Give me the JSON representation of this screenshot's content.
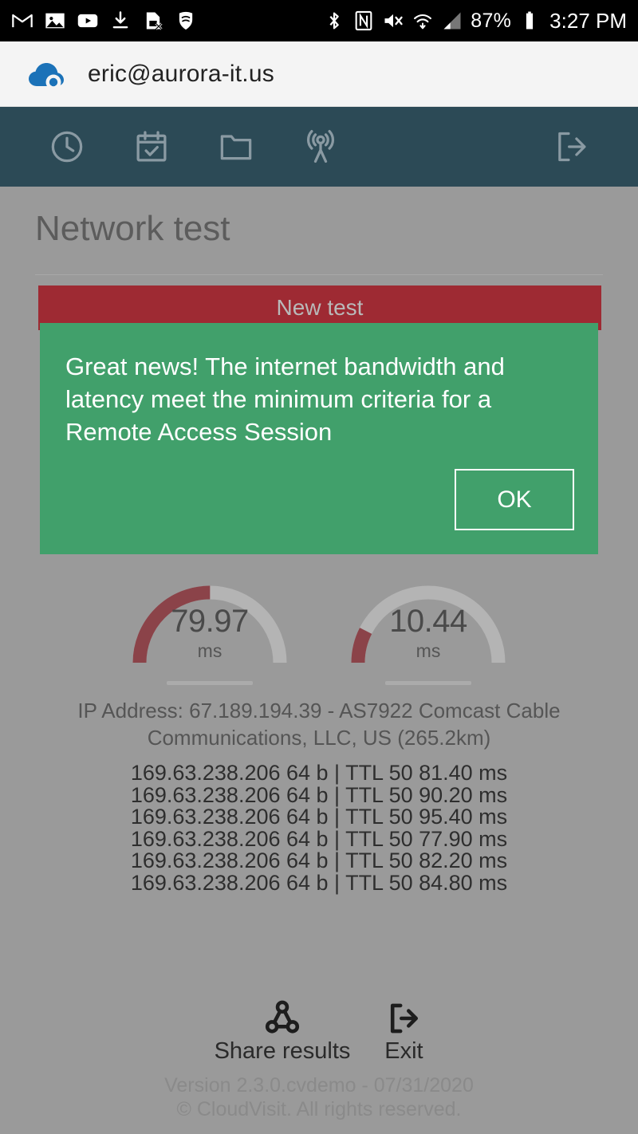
{
  "status_bar": {
    "notifications": [
      "gmail-icon",
      "photos-icon",
      "youtube-icon",
      "download-icon",
      "sim-card-error-icon",
      "shield-icon"
    ],
    "system": [
      "bluetooth-icon",
      "nfc-icon",
      "mute-icon",
      "wifi-icon",
      "cell-signal-icon"
    ],
    "battery_percent": "87%",
    "time": "3:27 PM"
  },
  "account": {
    "email": "eric@aurora-it.us",
    "logo": "cloudvisit-cloud-logo"
  },
  "nav": {
    "items": [
      {
        "name": "history",
        "icon": "clock-icon"
      },
      {
        "name": "appointments",
        "icon": "calendar-check-icon"
      },
      {
        "name": "files",
        "icon": "folder-icon"
      },
      {
        "name": "network-test",
        "icon": "broadcast-icon"
      }
    ],
    "logout": {
      "name": "logout",
      "icon": "logout-icon"
    }
  },
  "main": {
    "title": "Network test",
    "new_test_label": "New test"
  },
  "gauges": [
    {
      "name": "latency-gauge",
      "value": "79.97",
      "unit": "ms",
      "percent": 50
    },
    {
      "name": "jitter-gauge",
      "value": "10.44",
      "unit": "ms",
      "percent": 15
    }
  ],
  "ip_info": "IP Address: 67.189.194.39 - AS7922 Comcast Cable Communications, LLC, US (265.2km)",
  "ping_results": [
    "169.63.238.206 64 b | TTL 50 81.40 ms",
    "169.63.238.206 64 b | TTL 50 90.20 ms",
    "169.63.238.206 64 b | TTL 50 95.40 ms",
    "169.63.238.206 64 b | TTL 50 77.90 ms",
    "169.63.238.206 64 b | TTL 50 82.20 ms",
    "169.63.238.206 64 b | TTL 50 84.80 ms"
  ],
  "actions": {
    "share_label": "Share results",
    "exit_label": "Exit"
  },
  "footer": {
    "version": "Version 2.3.0.cvdemo - 07/31/2020",
    "copyright": "© CloudVisit. All rights reserved."
  },
  "dialog": {
    "message": "Great news! The internet bandwidth and latency meet the minimum criteria for a Remote Access Session",
    "ok_label": "OK"
  },
  "colors": {
    "nav_bar": "#2c4a56",
    "new_test": "#9e2a33",
    "dialog_green": "#41a06b",
    "gauge_fill": "#8b4349",
    "gauge_track": "#b4b4b4",
    "logo_blue": "#1b72b8",
    "scrim": "#9a9a9a"
  }
}
